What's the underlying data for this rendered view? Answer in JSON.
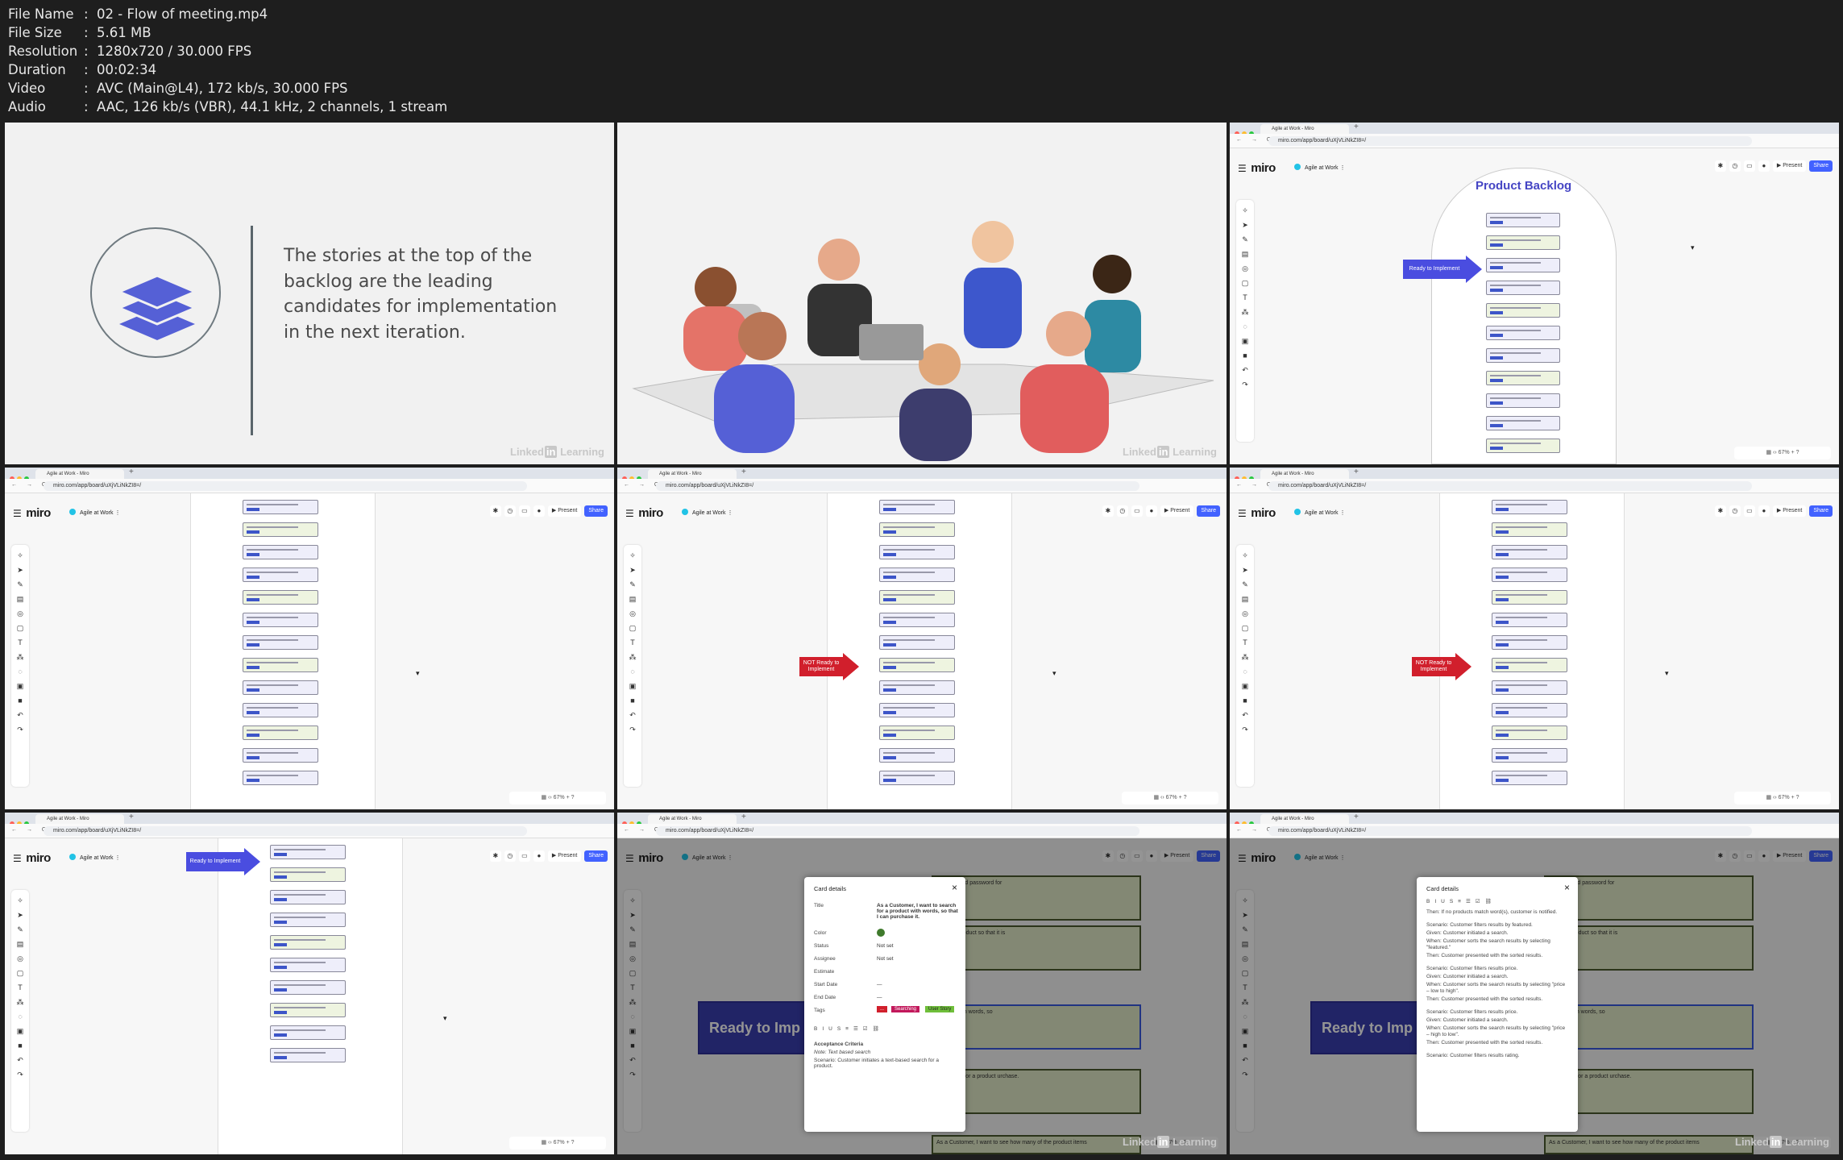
{
  "meta": {
    "rows": [
      {
        "key": "File Name",
        "value": "02 - Flow of meeting.mp4"
      },
      {
        "key": "File Size",
        "value": "5.61 MB"
      },
      {
        "key": "Resolution",
        "value": "1280x720 / 30.000 FPS"
      },
      {
        "key": "Duration",
        "value": "00:02:34"
      },
      {
        "key": "Video",
        "value": "AVC (Main@L4), 172 kb/s, 30.000 FPS"
      },
      {
        "key": "Audio",
        "value": "AAC, 126 kb/s (VBR), 44.1 kHz, 2 channels, 1 stream"
      }
    ]
  },
  "slide": {
    "text": "The stories at the top of the backlog are the leading candidates for implementation in the next iteration."
  },
  "watermark": {
    "brand": "Linked",
    "mark": "in",
    "suffix": "Learning"
  },
  "browser": {
    "tab_title": "Agile at Work - Miro",
    "url": "miro.com/app/board/uXjVLiNkZI8=/",
    "logo": "miro",
    "board_name": "Agile at Work",
    "present": "Present",
    "share": "Share",
    "nav": "← → C"
  },
  "backlog": {
    "title": "Product Backlog"
  },
  "arrows": {
    "ready": "Ready to Implement",
    "not_ready": "NOT Ready to Implement"
  },
  "card_details": {
    "header": "Card details",
    "title_label": "Title",
    "title_value": "As a Customer, I want to search for a product with words, so that I can purchase it.",
    "color_label": "Color",
    "status_label": "Status",
    "status_value": "Not set",
    "assignee_label": "Assignee",
    "assignee_value": "Not set",
    "estimate_label": "Estimate",
    "start_label": "Start Date",
    "start_value": "—",
    "end_label": "End Date",
    "end_value": "—",
    "tags_label": "Tags",
    "tag1": "...",
    "tag2": "Searching",
    "tag3": "User Story",
    "ac_title": "Acceptance Criteria",
    "ac_note": "Note: Text based search",
    "ac_scenario": "Scenario: Customer initiates a text-based search for a product."
  },
  "card_details2": {
    "lines": [
      "Then: If no products match word(s), customer is notified.",
      "Scenario: Customer filters results by featured.",
      "Given: Customer initiated a search.",
      "When: Customer sorts the search results by selecting \"featured.\"",
      "Then: Customer presented with the sorted results.",
      "Scenario: Customer filters results price.",
      "Given: Customer initiated a search.",
      "When: Customer sorts the search results by selecting \"price – low to high\".",
      "Then: Customer presented with the sorted results.",
      "Scenario: Customer filters results price.",
      "Given: Customer initiated a search.",
      "When: Customer sorts the search results by selecting \"price – high to low\".",
      "Then: Customer presented with the sorted results.",
      "Scenario: Customer filters results rating."
    ]
  },
  "board_bg": {
    "ready_big": "Ready to Imp",
    "s1": "er name and password for",
    "s2": "d a new product so that it is",
    "s3": "product with words, so",
    "s4": "the pricing for a product urchase.",
    "s5": "As a Customer, I want to see how many of the product items"
  }
}
